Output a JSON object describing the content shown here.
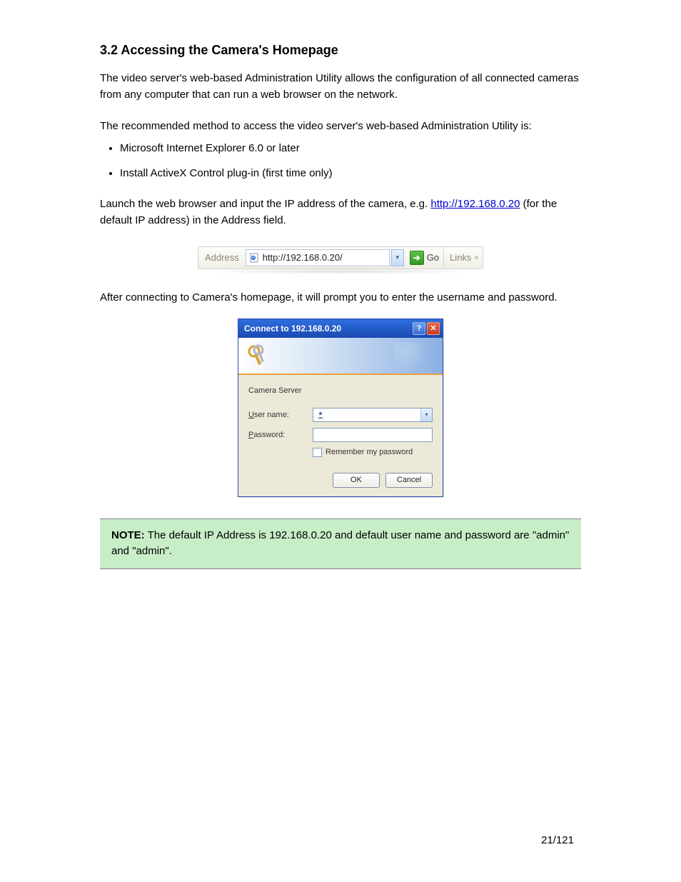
{
  "section_title": "3.2 Accessing the Camera's Homepage",
  "intro_text": "The video server's web-based Administration Utility allows the configuration of all connected cameras from any computer that can run a web browser on the network.",
  "requirements_intro": "The recommended method to access the video server's web-based Administration Utility is:",
  "requirements": [
    "Microsoft Internet Explorer 6.0 or later",
    "Install ActiveX Control plug-in (first time only)"
  ],
  "launch_text_prefix": "Launch the web browser and input the IP address of the camera, e.g. ",
  "launch_link": "http://192.168.0.20",
  "launch_text_suffix": " (for the default IP address) in the Address field.",
  "addressbar": {
    "label": "Address",
    "url": "http://192.168.0.20/",
    "go": "Go",
    "links": "Links"
  },
  "after_launch": "After connecting to Camera's homepage, it will prompt you to enter the username and password.",
  "dialog": {
    "title": "Connect to 192.168.0.20",
    "server_label": "Camera Server",
    "username_label_u": "U",
    "username_label_rest": "ser name:",
    "password_label_p": "P",
    "password_label_rest": "assword:",
    "remember_r": "R",
    "remember_rest": "emember my password",
    "ok": "OK",
    "cancel": "Cancel"
  },
  "note": {
    "prefix": "NOTE:",
    "body": " The default IP Address is 192.168.0.20 and default user name and password are \"admin\" and \"admin\"."
  },
  "page_number": "21/121"
}
